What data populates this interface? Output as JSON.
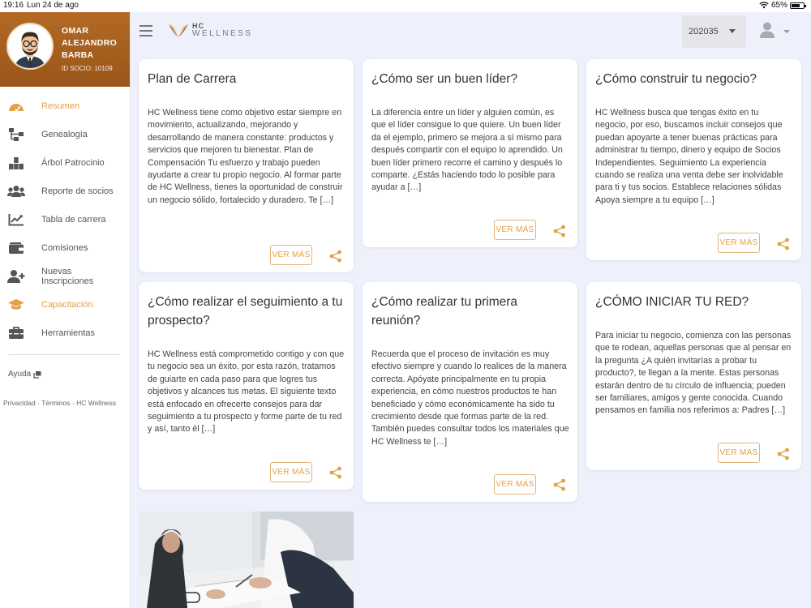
{
  "statusbar": {
    "time": "19:16",
    "date": "Lun 24 de ago",
    "battery": "65%",
    "battery_level": 0.65
  },
  "profile": {
    "name": "OMAR ALEJANDRO BARBA",
    "id": "ID SOCIO: 10109"
  },
  "menu": [
    {
      "label": "Resumen",
      "icon": "gauge-icon"
    },
    {
      "label": "Genealogía",
      "icon": "hierarchy-icon"
    },
    {
      "label": "Árbol Patrocinio",
      "icon": "blocks-icon"
    },
    {
      "label": "Reporte de socios",
      "icon": "group-icon"
    },
    {
      "label": "Tabla de carrera",
      "icon": "chart-line-icon"
    },
    {
      "label": "Comisiones",
      "icon": "wallet-icon"
    },
    {
      "label": "Nuevas Inscripciones",
      "icon": "user-plus-icon"
    },
    {
      "label": "Capacitación",
      "icon": "graduation-cap-icon"
    },
    {
      "label": "Herramientas",
      "icon": "toolbox-icon"
    }
  ],
  "help": {
    "label": "Ayuda"
  },
  "footer": {
    "links": "Privacidad · Términos · HC Wellness"
  },
  "logo": {
    "line1": "HC",
    "line2": "WELLNESS"
  },
  "period": {
    "value": "202035"
  },
  "colors": {
    "accent": "#e3a146",
    "profile_bg": "#a35d1d",
    "page_bg": "#eef0fb"
  },
  "cards": [
    {
      "title": "Plan de Carrera",
      "text": "HC Wellness tiene como objetivo estar siempre en movimiento, actualizando, mejorando y desarrollando de manera constante: productos y servicios que mejoren tu bienestar.  Plan de Compensación Tu esfuerzo y trabajo pueden ayudarte a crear tu propio negocio. Al formar parte de HC Wellness, tienes la oportunidad de construir un negocio sólido, fortalecido y duradero. Te […]",
      "button": "VER MÁS"
    },
    {
      "title": "¿Cómo ser un buen líder?",
      "text": "La diferencia entre un líder y alguien común, es que el líder consigue lo que quiere. Un buen líder da el ejemplo, primero se mejora a sí mismo para después compartir con el equipo lo aprendido. Un buen líder primero recorre el camino y después lo comparte. ¿Estás haciendo todo lo posible para ayudar a […]",
      "button": "VER MÁS"
    },
    {
      "title": "¿Cómo construir tu negocio?",
      "text": "HC Wellness busca que tengas éxito en tu negocio, por eso, buscamos incluir consejos que puedan apoyarte a tener buenas prácticas para administrar tu tiempo, dinero y equipo de Socios Independientes. Seguimiento La experiencia cuando se realiza una venta debe ser inolvidable para ti y tus socios. Establece relaciones sólidas Apoya siempre a tu equipo […]",
      "button": "VER MÁS"
    },
    {
      "title": "¿Cómo realizar el seguimiento a tu prospecto?",
      "text": "HC Wellness está comprometido contigo y con que tu negocio sea un éxito, por esta razón, tratamos de guiarte en cada paso para que logres tus objetivos y alcances tus metas. El siguiente texto está enfocado en ofrecerte consejos para dar seguimiento a tu prospecto y forme parte de tu red y así, tanto él […]",
      "button": "VER MÁS"
    },
    {
      "title": "¿Cómo realizar tu primera reunión?",
      "text": "Recuerda que el proceso de invitación es muy efectivo siempre y cuando lo realices de la manera correcta. Apóyate principalmente en tu propia experiencia, en cómo nuestros productos te han beneficiado y cómo económicamente ha sido tu crecimiento desde que formas parte de la red. También puedes consultar todos los materiales que HC Wellness te […]",
      "button": "VER MÁS"
    },
    {
      "title": "¿CÓMO INICIAR TU RED?",
      "text": "Para iniciar tu negocio, comienza con las personas que te rodean, aquellas personas que al pensar en la pregunta ¿A quién invitarías a probar tu producto?, te llegan a la mente. Estas personas estarán dentro de tu círculo de influencia; pueden ser familiares, amigos y gente conocida. Cuando pensamos en familia nos referimos a: Padres […]",
      "button": "VER MÁS"
    }
  ]
}
